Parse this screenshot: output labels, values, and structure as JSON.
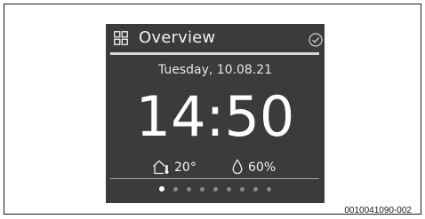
{
  "header": {
    "title": "Overview",
    "menu_icon": "grid-icon",
    "confirm_icon": "check-circle-icon"
  },
  "main": {
    "date": "Tuesday, 10.08.21",
    "time": "14:50",
    "temperature": "20°",
    "temperature_icon": "house-thermometer-icon",
    "humidity": "60%",
    "humidity_icon": "drop-icon"
  },
  "pager": {
    "total": 9,
    "active": 1
  },
  "figure_id": "0010041090-002",
  "colors": {
    "screen_bg": "#3b3b3b",
    "text": "#ffffff",
    "divider": "#d9d9d9"
  }
}
